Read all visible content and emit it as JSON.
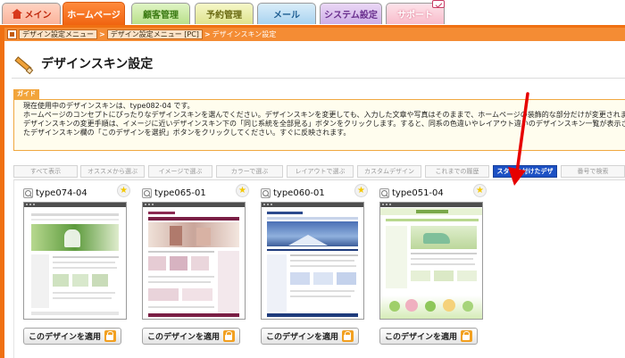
{
  "tabs": {
    "home": "メイン",
    "homepage": "ホームページ",
    "customer": "顧客管理",
    "booking": "予約管理",
    "mail": "メール",
    "system": "システム設定",
    "support": "サポート"
  },
  "breadcrumb": {
    "item1": "デザイン設定メニュー",
    "item2": "デザイン設定メニュー [PC]",
    "current": "デザインスキン設定",
    "sep": ">"
  },
  "page": {
    "title": "デザインスキン設定"
  },
  "guide": {
    "tag": "ガイド",
    "line1": "現在使用中のデザインスキンは、type082-04 です。",
    "line2": "ホームページのコンセプトにぴったりなデザインスキンを選んでください。デザインスキンを変更しても、入力した文章や写真はそのままで、ホームページの装飾的な部分だけが変更されます。",
    "line3": "デザインスキンの変更手順は、イメージに近いデザインスキン下の「同じ系統を全部見る」ボタンをクリックします。すると、同系の色違いやレイアウト違いのデザインスキン一覧が表示されるので、気に入っ",
    "line4": "たデザインスキン欄の「このデザインを選択」ボタンをクリックしてください。すぐに反映されます。"
  },
  "filters": [
    "すべて表示",
    "オススメから選ぶ",
    "イメージで選ぶ",
    "カラーで選ぶ",
    "レイアウトで選ぶ",
    "カスタムデザイン",
    "これまでの履歴",
    "スターを付けたデザ",
    "番号で検索"
  ],
  "cards": [
    {
      "name": "type074-04",
      "button": "このデザインを適用"
    },
    {
      "name": "type065-01",
      "button": "このデザインを適用"
    },
    {
      "name": "type060-01",
      "button": "このデザインを適用"
    },
    {
      "name": "type051-04",
      "button": "このデザインを適用"
    }
  ],
  "colors": {
    "accent_orange": "#f07012",
    "active_filter": "#1d51c4",
    "arrow": "#e60000"
  }
}
